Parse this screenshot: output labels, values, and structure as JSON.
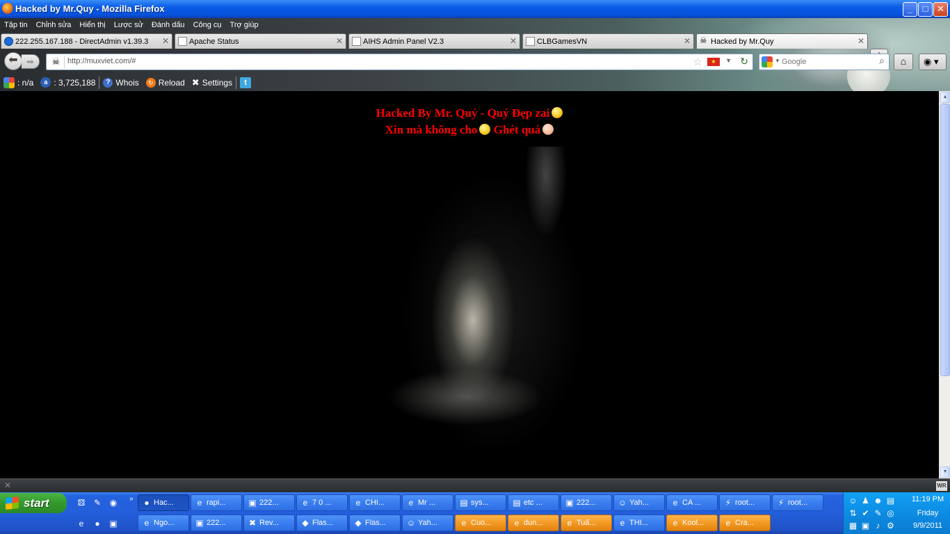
{
  "window": {
    "title": "Hacked by Mr.Quy - Mozilla Firefox",
    "min": "_",
    "max": "□",
    "close": "✕"
  },
  "menu": [
    "Tập tin",
    "Chỉnh sửa",
    "Hiển thị",
    "Lược sử",
    "Đánh dấu",
    "Công cụ",
    "Trợ giúp"
  ],
  "tabs": [
    {
      "label": "222.255.167.188 - DirectAdmin v1.39.3"
    },
    {
      "label": "Apache Status"
    },
    {
      "label": "AIHS Admin Panel V2.3"
    },
    {
      "label": "CLBGamesVN"
    },
    {
      "label": "Hacked by Mr.Quy"
    }
  ],
  "nav": {
    "url": "http://muxviet.com/#",
    "search_placeholder": "Google"
  },
  "addon": {
    "pagerank": ": n/a",
    "alexa": ": 3,725,188",
    "whois": "Whois",
    "reload": "Reload",
    "settings": "Settings"
  },
  "page": {
    "line1": "Hacked By Mr. Quý - Quý Đẹp zai",
    "line2a": "Xin mà không cho",
    "line2b": "Ghét quá"
  },
  "taskbar": {
    "start": "start",
    "row1": [
      "Hac...",
      "rapi...",
      "222...",
      "7 0 ...",
      "CHI...",
      "Mr ...",
      "sys...",
      "etc ...",
      "222...",
      "Yah...",
      "CA ...",
      "root...",
      "root..."
    ],
    "row2": [
      "Ngo...",
      "222...",
      "Rev...",
      "Flas...",
      "Flas...",
      "Yah...",
      "Cuo...",
      "dun...",
      "Tuấ...",
      "THI...",
      "Kool...",
      "Cra..."
    ],
    "time": "11:19 PM",
    "day": "Friday",
    "date": "9/9/2011"
  },
  "colors": {
    "message": "#ff0000",
    "taskbar": "#245edb",
    "start": "#33992d"
  }
}
